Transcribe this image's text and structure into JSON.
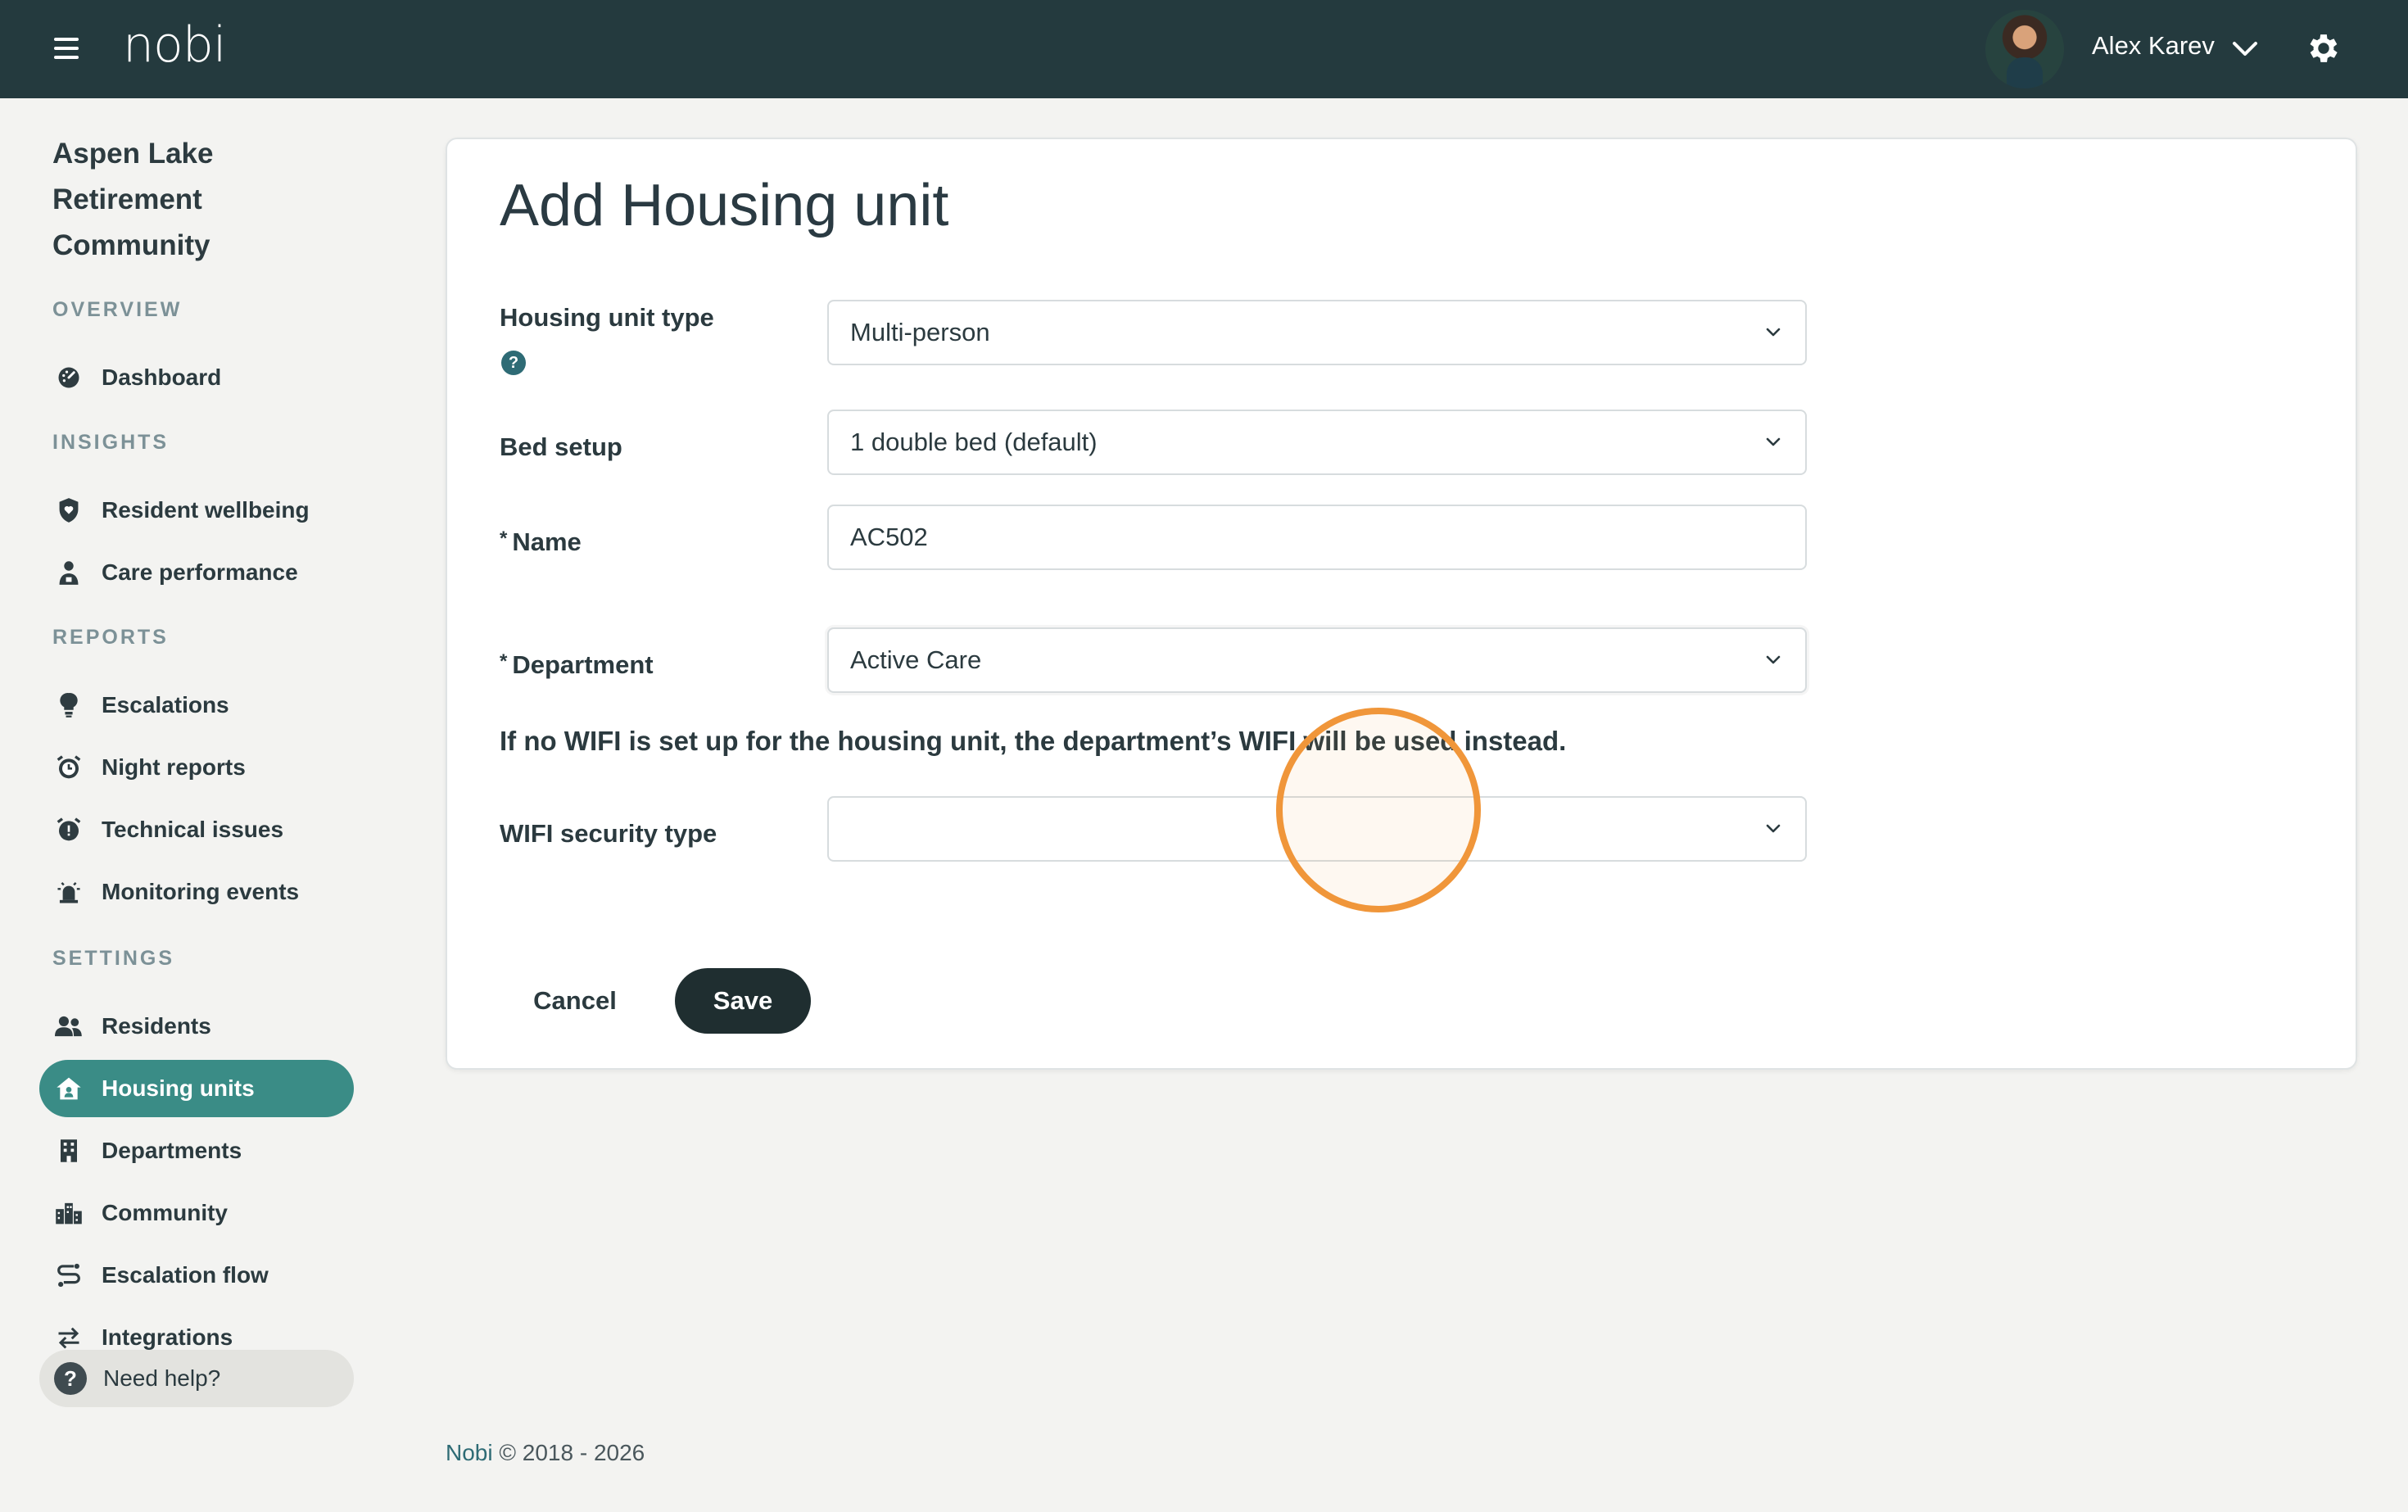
{
  "header": {
    "logo": "nobi",
    "user_name": "Alex Karev"
  },
  "sidebar": {
    "community_name": "Aspen Lake Retirement Community",
    "sections": {
      "overview": "OVERVIEW",
      "insights": "INSIGHTS",
      "reports": "REPORTS",
      "settings": "SETTINGS"
    },
    "items": {
      "dashboard": "Dashboard",
      "resident_wellbeing": "Resident wellbeing",
      "care_performance": "Care performance",
      "escalations": "Escalations",
      "night_reports": "Night reports",
      "technical_issues": "Technical issues",
      "monitoring_events": "Monitoring events",
      "residents": "Residents",
      "housing_units": "Housing units",
      "departments": "Departments",
      "community": "Community",
      "escalation_flow": "Escalation flow",
      "integrations": "Integrations"
    },
    "active_item": "Housing units",
    "help": "Need help?"
  },
  "form": {
    "title": "Add Housing unit",
    "housing_unit_type": {
      "label": "Housing unit type",
      "value": "Multi-person"
    },
    "bed_setup": {
      "label": "Bed setup",
      "value": "1 double bed (default)"
    },
    "name": {
      "label": "Name",
      "required_mark": "*",
      "value": "AC502"
    },
    "department": {
      "label": "Department",
      "required_mark": "*",
      "value": "Active Care"
    },
    "wifi_info": "If no WIFI is set up for the housing unit, the department’s WIFI will be used instead.",
    "wifi_security_type": {
      "label": "WIFI security type",
      "value": ""
    },
    "cancel_label": "Cancel",
    "save_label": "Save"
  },
  "footer": {
    "brand": "Nobi",
    "copyright": "© 2018 - 2026"
  },
  "colors": {
    "topbar": "#243a3e",
    "accent": "#3a8c86",
    "save_button": "#1f2e30",
    "click_highlight": "#f0963a"
  }
}
